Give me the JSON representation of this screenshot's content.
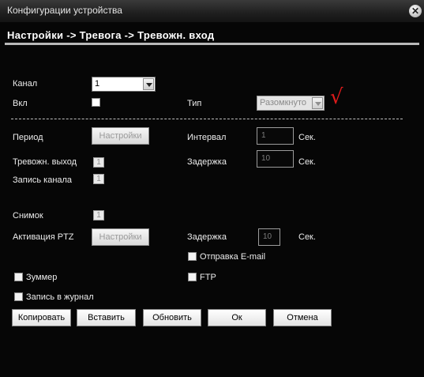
{
  "window": {
    "title": "Конфигурации устройства",
    "close_glyph": "✕"
  },
  "breadcrumb": "Настройки -> Тревога -> Тревожн. вход",
  "form": {
    "channel_label": "Канал",
    "channel_value": "1",
    "enable_label": "Вкл",
    "type_label": "Тип",
    "type_value": "Разомкнуто",
    "period_label": "Период",
    "settings_btn": "Настройки",
    "interval_label": "Интервал",
    "interval_value": "1",
    "sec_unit": "Сек.",
    "alarm_out_label": "Тревожн. выход",
    "alarm_out_value": "1",
    "delay_label": "Задержка",
    "delay_value": "10",
    "record_channel_label": "Запись канала",
    "record_channel_value": "1",
    "snapshot_label": "Снимок",
    "snapshot_value": "1",
    "ptz_label": "Активация PTZ",
    "ptz_settings_btn": "Настройки",
    "delay2_label": "Задержка",
    "delay2_value": "10",
    "email_label": "Отправка E-mail",
    "buzzer_label": "Зуммер",
    "ftp_label": "FTP",
    "log_label": "Запись в журнал"
  },
  "buttons": {
    "copy": "Копировать",
    "paste": "Вставить",
    "refresh": "Обновить",
    "ok": "Ок",
    "cancel": "Отмена"
  },
  "annotation_mark": "√",
  "colors": {
    "annotation": "#e01b1b",
    "background": "#060606"
  }
}
